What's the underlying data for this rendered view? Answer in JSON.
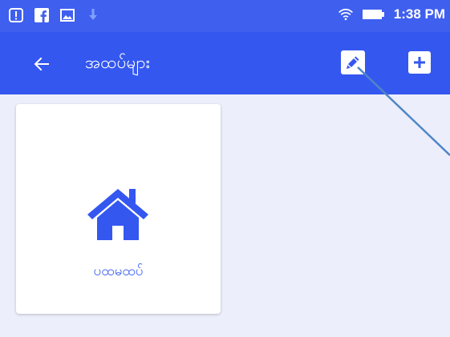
{
  "status_bar": {
    "time": "1:38 PM",
    "left_icons": [
      "alert-icon",
      "facebook-icon",
      "image-icon",
      "download-icon"
    ],
    "right_icons": [
      "wifi-icon",
      "battery-icon"
    ]
  },
  "app_bar": {
    "title": "အထပ်များ",
    "back_icon": "arrow-left-icon",
    "edit_icon": "pencil-icon",
    "add_icon": "plus-icon"
  },
  "floors": [
    {
      "label": "ပထမထပ်",
      "icon": "home-icon"
    }
  ],
  "colors": {
    "primary": "#3457f0",
    "status_bar": "#3f5fef",
    "background": "#eceefb",
    "card": "#ffffff",
    "annotation_line": "#4f86c6"
  }
}
